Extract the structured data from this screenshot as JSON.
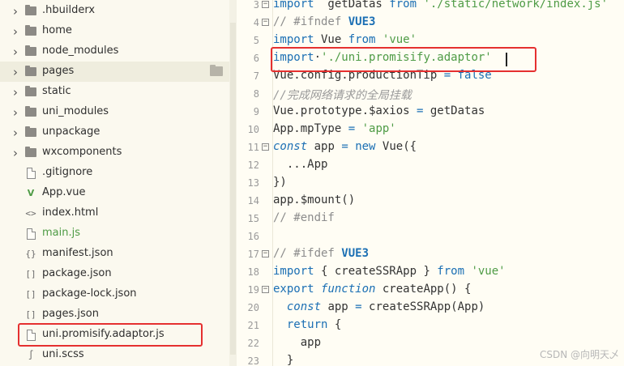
{
  "explorer": {
    "items": [
      {
        "label": ".hbuilderx",
        "kind": "folder",
        "icon": "folder-icon",
        "expandable": true
      },
      {
        "label": "home",
        "kind": "folder",
        "icon": "folder-icon",
        "expandable": true
      },
      {
        "label": "node_modules",
        "kind": "folder",
        "icon": "folder-icon",
        "expandable": true
      },
      {
        "label": "pages",
        "kind": "folder",
        "icon": "folder-icon",
        "expandable": true,
        "selected": true
      },
      {
        "label": "static",
        "kind": "folder",
        "icon": "folder-icon",
        "expandable": true
      },
      {
        "label": "uni_modules",
        "kind": "folder",
        "icon": "folder-icon",
        "expandable": true
      },
      {
        "label": "unpackage",
        "kind": "folder",
        "icon": "folder-icon",
        "expandable": true
      },
      {
        "label": "wxcomponents",
        "kind": "folder",
        "icon": "folder-icon",
        "expandable": true
      },
      {
        "label": ".gitignore",
        "kind": "file",
        "icon": "file-icon",
        "glyph": ""
      },
      {
        "label": "App.vue",
        "kind": "file",
        "icon": "vue-file-icon",
        "glyph": "V"
      },
      {
        "label": "index.html",
        "kind": "file",
        "icon": "html-file-icon",
        "glyph": "<>"
      },
      {
        "label": "main.js",
        "kind": "file",
        "icon": "js-file-icon",
        "glyph": "",
        "active": true
      },
      {
        "label": "manifest.json",
        "kind": "file",
        "icon": "json-file-icon",
        "glyph": "{}"
      },
      {
        "label": "package.json",
        "kind": "file",
        "icon": "json-file-icon",
        "glyph": "[]"
      },
      {
        "label": "package-lock.json",
        "kind": "file",
        "icon": "json-file-icon",
        "glyph": "[]"
      },
      {
        "label": "pages.json",
        "kind": "file",
        "icon": "json-file-icon",
        "glyph": "[]"
      },
      {
        "label": "uni.promisify.adaptor.js",
        "kind": "file",
        "icon": "js-file-icon",
        "glyph": ""
      },
      {
        "label": "uni.scss",
        "kind": "file",
        "icon": "scss-file-icon",
        "glyph": "∫"
      }
    ]
  },
  "editor": {
    "lines": [
      {
        "n": "3",
        "fold": "minus",
        "tokens": [
          [
            "kw",
            "import"
          ],
          [
            "",
            "  getDatas "
          ],
          [
            "kw",
            "from"
          ],
          [
            "",
            " "
          ],
          [
            "str",
            "'./static/network/index.js'"
          ]
        ]
      },
      {
        "n": "4",
        "fold": "minus",
        "tokens": [
          [
            "cm",
            "// #ifndef "
          ],
          [
            "macro",
            "VUE3"
          ]
        ]
      },
      {
        "n": "5",
        "fold": "",
        "tokens": [
          [
            "kw",
            "import"
          ],
          [
            "",
            " Vue "
          ],
          [
            "kw",
            "from"
          ],
          [
            "",
            " "
          ],
          [
            "str",
            "'vue'"
          ]
        ]
      },
      {
        "n": "6",
        "fold": "",
        "tokens": [
          [
            "kw",
            "import"
          ],
          [
            "",
            "·"
          ],
          [
            "str",
            "'./uni.promisify.adaptor'"
          ]
        ]
      },
      {
        "n": "7",
        "fold": "",
        "tokens": [
          [
            "",
            "Vue.config.productionTip "
          ],
          [
            "kw",
            "="
          ],
          [
            "",
            " "
          ],
          [
            "kw",
            "false"
          ]
        ]
      },
      {
        "n": "8",
        "fold": "",
        "tokens": [
          [
            "cmi",
            "//完成网络请求的全局挂载"
          ]
        ]
      },
      {
        "n": "9",
        "fold": "",
        "tokens": [
          [
            "",
            "Vue.prototype.$axios "
          ],
          [
            "kw",
            "="
          ],
          [
            "",
            " getDatas"
          ]
        ]
      },
      {
        "n": "10",
        "fold": "",
        "tokens": [
          [
            "",
            "App.mpType "
          ],
          [
            "kw",
            "="
          ],
          [
            "",
            " "
          ],
          [
            "str",
            "'app'"
          ]
        ]
      },
      {
        "n": "11",
        "fold": "minus",
        "tokens": [
          [
            "kwi",
            "const"
          ],
          [
            "",
            " app "
          ],
          [
            "kw",
            "="
          ],
          [
            "",
            " "
          ],
          [
            "kw",
            "new"
          ],
          [
            "",
            " Vue({"
          ]
        ]
      },
      {
        "n": "12",
        "fold": "",
        "tokens": [
          [
            "",
            "  ...App"
          ]
        ]
      },
      {
        "n": "13",
        "fold": "",
        "tokens": [
          [
            "",
            "})"
          ]
        ]
      },
      {
        "n": "14",
        "fold": "",
        "tokens": [
          [
            "",
            "app.$mount()"
          ]
        ]
      },
      {
        "n": "15",
        "fold": "",
        "tokens": [
          [
            "cm",
            "// #endif"
          ]
        ]
      },
      {
        "n": "16",
        "fold": "",
        "tokens": []
      },
      {
        "n": "17",
        "fold": "minus",
        "tokens": [
          [
            "cm",
            "// #ifdef "
          ],
          [
            "macro",
            "VUE3"
          ]
        ]
      },
      {
        "n": "18",
        "fold": "",
        "tokens": [
          [
            "kw",
            "import"
          ],
          [
            "",
            " { createSSRApp } "
          ],
          [
            "kw",
            "from"
          ],
          [
            "",
            " "
          ],
          [
            "str",
            "'vue'"
          ]
        ]
      },
      {
        "n": "19",
        "fold": "minus",
        "tokens": [
          [
            "kw",
            "export"
          ],
          [
            "",
            " "
          ],
          [
            "kwi",
            "function"
          ],
          [
            "",
            " createApp() {"
          ]
        ]
      },
      {
        "n": "20",
        "fold": "",
        "tokens": [
          [
            "",
            "  "
          ],
          [
            "kwi",
            "const"
          ],
          [
            "",
            " app "
          ],
          [
            "kw",
            "="
          ],
          [
            "",
            " createSSRApp(App)"
          ]
        ]
      },
      {
        "n": "21",
        "fold": "",
        "tokens": [
          [
            "",
            "  "
          ],
          [
            "kw",
            "return"
          ],
          [
            "",
            " {"
          ]
        ]
      },
      {
        "n": "22",
        "fold": "",
        "tokens": [
          [
            "",
            "    app"
          ]
        ]
      },
      {
        "n": "23",
        "fold": "",
        "tokens": [
          [
            "",
            "  }"
          ]
        ]
      }
    ]
  },
  "watermark": "CSDN @向明天乄",
  "colors": {
    "highlight_box": "#e53030",
    "keyword": "#1b6fb4",
    "string": "#4e9b45",
    "comment": "#8c8c8c"
  }
}
